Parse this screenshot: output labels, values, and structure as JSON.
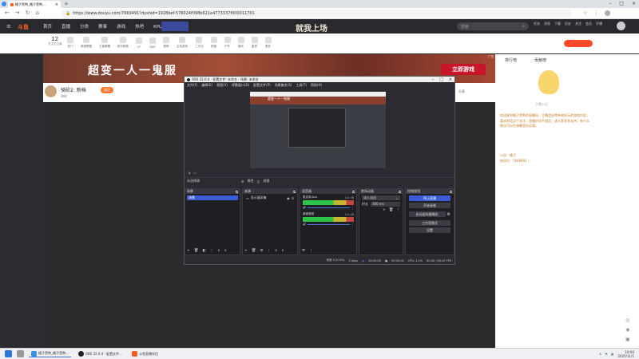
{
  "browser": {
    "tab_title": "橘子黑鸭_橘子黑鸭...",
    "url": "https://www.douyu.com/7669491?dyshid=1928bef-576024f098b621e4773337f000011701"
  },
  "nav": {
    "logo": "斗鱼",
    "links": [
      "首页",
      "直播",
      "分类",
      "赛事",
      "游戏",
      "热吧",
      "KPL春季"
    ],
    "center_banner": "就我上场",
    "search_placeholder": "搜索",
    "user_items": [
      "任务",
      "消息",
      "下载",
      "历史",
      "关注",
      "会员",
      "开播"
    ]
  },
  "icon_row": {
    "count": "12",
    "count_label": "关注的主播",
    "items": [
      "热门",
      "英雄联盟",
      "王者荣耀",
      "和平精英",
      "CF",
      "DNF",
      "原神",
      "主机游戏",
      "二次元",
      "颜值",
      "户外",
      "娱乐",
      "星秀",
      "更多"
    ]
  },
  "banner": {
    "left_text": "超变一人一鬼服",
    "button": "立即游戏",
    "ad_label": "广告"
  },
  "room": {
    "title": "骑砍2: 新档",
    "category": "骑砍",
    "follow": "关注",
    "share": "分享"
  },
  "obs": {
    "title": "OBS 32.0.4 - 配置文件: 未命名 - 场景: 未命名",
    "menu": [
      "文件(F)",
      "编辑(E)",
      "视图(V)",
      "停靠窗口(D)",
      "配置文件(P)",
      "场景集合(S)",
      "工具(T)",
      "帮助(H)"
    ],
    "mini_preview_banner": "超变一人一鬼服",
    "no_source": "未选择源",
    "properties": "属性",
    "filters": "滤镜",
    "docks": {
      "scenes": "场景",
      "sources": "来源",
      "mixer": "混音器",
      "transitions": "转场动画",
      "controls": "控制按钮"
    },
    "scene_item": "场景",
    "source_item": "显示器采集",
    "mixer_tracks": [
      {
        "name": "桌面音频",
        "db": "0.0 dB"
      },
      {
        "name": "麦克风/Aux",
        "db": "0.0 dB"
      }
    ],
    "transition_type": "淡入淡出",
    "duration_label": "时长",
    "duration": "300 ms",
    "controls": [
      "停止直播",
      "开始录制",
      "启动虚拟摄像机",
      "工作室模式",
      "设置"
    ],
    "status": {
      "dropped": "丢帧 0 (0.0%)",
      "bitrate": "0 kbps",
      "live_time": "00:00:00",
      "rec_time": "00:00:00",
      "cpu": "CPU: 2.2%",
      "fps": "60.00 / 60.00 FPS"
    }
  },
  "side": {
    "tabs": [
      "排行榜",
      "贡献榜"
    ],
    "announcement_title": "主播公告",
    "text": "欢迎来到橘子黑鸭的直播间，主播会经常带来好玩的游戏内容，喜欢的话点个关注，直播时间不固定，请大家多多支持，有什么建议可以在弹幕里告诉我。",
    "info1": "公告：橘子",
    "info2": "房间号：7669491"
  },
  "taskbar": {
    "items": [
      "橘子黑鸭_橘子黑鸭...",
      "OBS 32.0.4 - 配置文件...",
      "斗鱼直播伴侣"
    ],
    "time": "19:00",
    "date": "2025/11/1"
  },
  "colors": {
    "accent": "#ff5d23",
    "obs_blue": "#3b5cd6",
    "meter_green": "#2bc34a"
  }
}
